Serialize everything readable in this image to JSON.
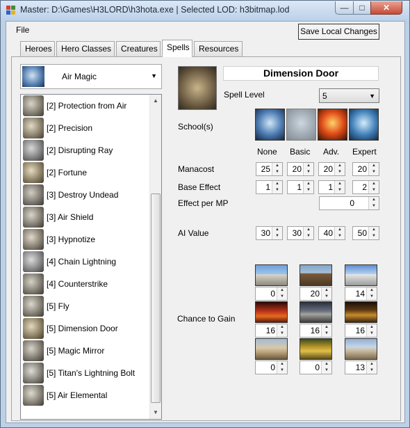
{
  "window": {
    "title": "Master: D:\\Games\\H3LORD\\h3hota.exe | Selected LOD: h3bitmap.lod",
    "min_glyph": "—",
    "max_glyph": "□",
    "close_glyph": "✕"
  },
  "menu": {
    "file": "File"
  },
  "toolbar": {
    "save_label": "Save Local Changes"
  },
  "tabs": [
    {
      "label": "Heroes",
      "active": false
    },
    {
      "label": "Hero Classes",
      "active": false
    },
    {
      "label": "Creatures",
      "active": false
    },
    {
      "label": "Spells",
      "active": true
    },
    {
      "label": "Resources",
      "active": false
    }
  ],
  "school_select": {
    "value": "Air Magic",
    "arrow": "▼",
    "icon": "air-magic-icon"
  },
  "spell_list": {
    "items": [
      {
        "label": "[2] Protection from Air",
        "icon": "protection-from-air-icon"
      },
      {
        "label": "[2] Precision",
        "icon": "precision-icon"
      },
      {
        "label": "[2] Disrupting Ray",
        "icon": "disrupting-ray-icon"
      },
      {
        "label": "[2] Fortune",
        "icon": "fortune-icon"
      },
      {
        "label": "[3] Destroy Undead",
        "icon": "destroy-undead-icon"
      },
      {
        "label": "[3] Air Shield",
        "icon": "air-shield-icon"
      },
      {
        "label": "[3] Hypnotize",
        "icon": "hypnotize-icon"
      },
      {
        "label": "[4] Chain Lightning",
        "icon": "chain-lightning-icon"
      },
      {
        "label": "[4] Counterstrike",
        "icon": "counterstrike-icon"
      },
      {
        "label": "[5] Fly",
        "icon": "fly-icon"
      },
      {
        "label": "[5] Dimension Door",
        "icon": "dimension-door-icon"
      },
      {
        "label": "[5] Magic Mirror",
        "icon": "magic-mirror-icon"
      },
      {
        "label": "[5] Titan's Lightning Bolt",
        "icon": "titans-lightning-bolt-icon"
      },
      {
        "label": "[5] Air Elemental",
        "icon": "air-elemental-icon"
      }
    ],
    "scroll_up": "▲",
    "scroll_down": "▼"
  },
  "spell": {
    "name": "Dimension Door",
    "level_label": "Spell Level",
    "level_value": "5",
    "level_arrow": "▼",
    "schools_label": "School(s)",
    "schools": [
      {
        "icon": "air-school-icon",
        "enabled": true
      },
      {
        "icon": "earth-school-icon",
        "enabled": false
      },
      {
        "icon": "fire-school-icon",
        "enabled": true
      },
      {
        "icon": "water-school-icon",
        "enabled": true
      }
    ],
    "columns": [
      "None",
      "Basic",
      "Adv.",
      "Expert"
    ],
    "manacost": {
      "label": "Manacost",
      "values": [
        "25",
        "20",
        "20",
        "20"
      ]
    },
    "base_effect": {
      "label": "Base Effect",
      "values": [
        "1",
        "1",
        "1",
        "2"
      ]
    },
    "effect_per_mp": {
      "label": "Effect per MP",
      "value": "0"
    },
    "ai_value": {
      "label": "AI Value",
      "values": [
        "30",
        "30",
        "40",
        "50"
      ]
    },
    "chance_label": "Chance to Gain",
    "towns": [
      {
        "icon": "castle-town-icon",
        "value": "0"
      },
      {
        "icon": "rampart-town-icon",
        "value": "20"
      },
      {
        "icon": "tower-town-icon",
        "value": "14"
      },
      {
        "icon": "inferno-town-icon",
        "value": "16"
      },
      {
        "icon": "necropolis-town-icon",
        "value": "16"
      },
      {
        "icon": "dungeon-town-icon",
        "value": "16"
      },
      {
        "icon": "stronghold-town-icon",
        "value": "0"
      },
      {
        "icon": "fortress-town-icon",
        "value": "0"
      },
      {
        "icon": "conflux-town-icon",
        "value": "13"
      }
    ],
    "spin_up": "▲",
    "spin_down": "▼"
  }
}
